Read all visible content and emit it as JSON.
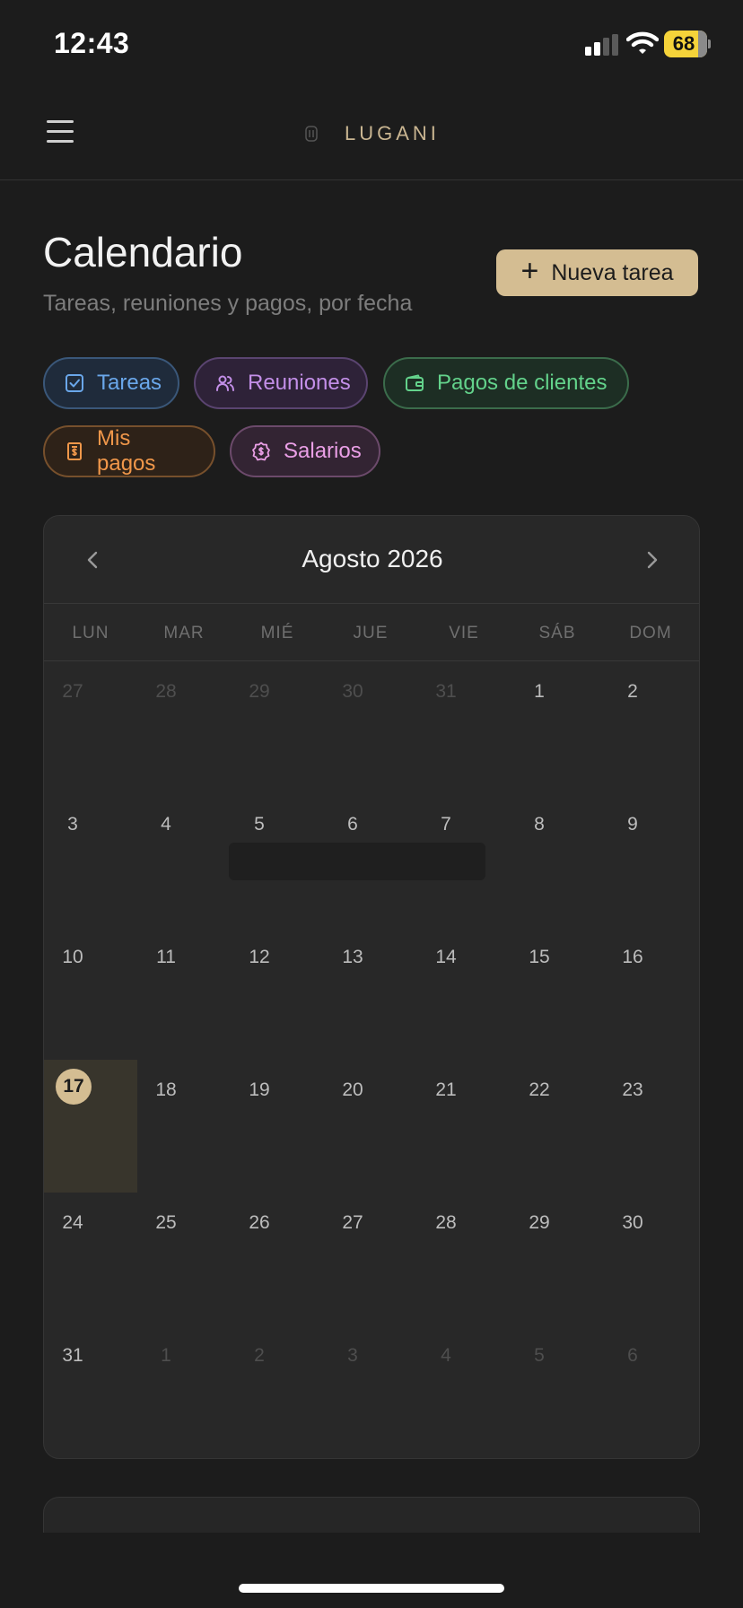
{
  "status_bar": {
    "time": "12:43",
    "battery": "68",
    "icons": [
      "signal-icon",
      "wifi-icon",
      "battery-icon"
    ]
  },
  "nav": {
    "brand": "LUGANI",
    "menu_icon": "hamburger-menu-icon"
  },
  "header": {
    "title": "Calendario",
    "subtitle": "Tareas, reuniones y pagos, por fecha",
    "new_task_icon": "plus-icon",
    "new_task_label": "Nueva tarea"
  },
  "filters": [
    {
      "label": "Tareas",
      "icon": "checkbox-icon",
      "color": "#6aa7ea"
    },
    {
      "label": "Reuniones",
      "icon": "users-icon",
      "color": "#c38fe8"
    },
    {
      "label": "Pagos de clientes",
      "icon": "wallet-icon",
      "color": "#63d28b"
    },
    {
      "label": "Mis pagos",
      "icon": "receipt-icon",
      "color": "#f0974a"
    },
    {
      "label": "Salarios",
      "icon": "dollar-badge-icon",
      "color": "#ea9fe6"
    }
  ],
  "calendar": {
    "month_label": "Agosto 2026",
    "prev_icon": "chevron-left-icon",
    "next_icon": "chevron-right-icon",
    "weekdays": [
      "LUN",
      "MAR",
      "MIÉ",
      "JUE",
      "VIE",
      "SÁB",
      "DOM"
    ],
    "weeks": [
      [
        {
          "d": "27",
          "muted": true
        },
        {
          "d": "28",
          "muted": true
        },
        {
          "d": "29",
          "muted": true
        },
        {
          "d": "30",
          "muted": true
        },
        {
          "d": "31",
          "muted": true
        },
        {
          "d": "1"
        },
        {
          "d": "2"
        }
      ],
      [
        {
          "d": "3"
        },
        {
          "d": "4"
        },
        {
          "d": "5"
        },
        {
          "d": "6"
        },
        {
          "d": "7"
        },
        {
          "d": "8"
        },
        {
          "d": "9"
        }
      ],
      [
        {
          "d": "10"
        },
        {
          "d": "11"
        },
        {
          "d": "12"
        },
        {
          "d": "13"
        },
        {
          "d": "14"
        },
        {
          "d": "15"
        },
        {
          "d": "16"
        }
      ],
      [
        {
          "d": "17",
          "today": true
        },
        {
          "d": "18"
        },
        {
          "d": "19"
        },
        {
          "d": "20"
        },
        {
          "d": "21"
        },
        {
          "d": "22"
        },
        {
          "d": "23"
        }
      ],
      [
        {
          "d": "24"
        },
        {
          "d": "25"
        },
        {
          "d": "26"
        },
        {
          "d": "27"
        },
        {
          "d": "28"
        },
        {
          "d": "29"
        },
        {
          "d": "30"
        }
      ],
      [
        {
          "d": "31"
        },
        {
          "d": "1",
          "muted": true
        },
        {
          "d": "2",
          "muted": true
        },
        {
          "d": "3",
          "muted": true
        },
        {
          "d": "4",
          "muted": true
        },
        {
          "d": "5",
          "muted": true
        },
        {
          "d": "6",
          "muted": true
        }
      ]
    ],
    "accent_color": "#d4bd92"
  }
}
